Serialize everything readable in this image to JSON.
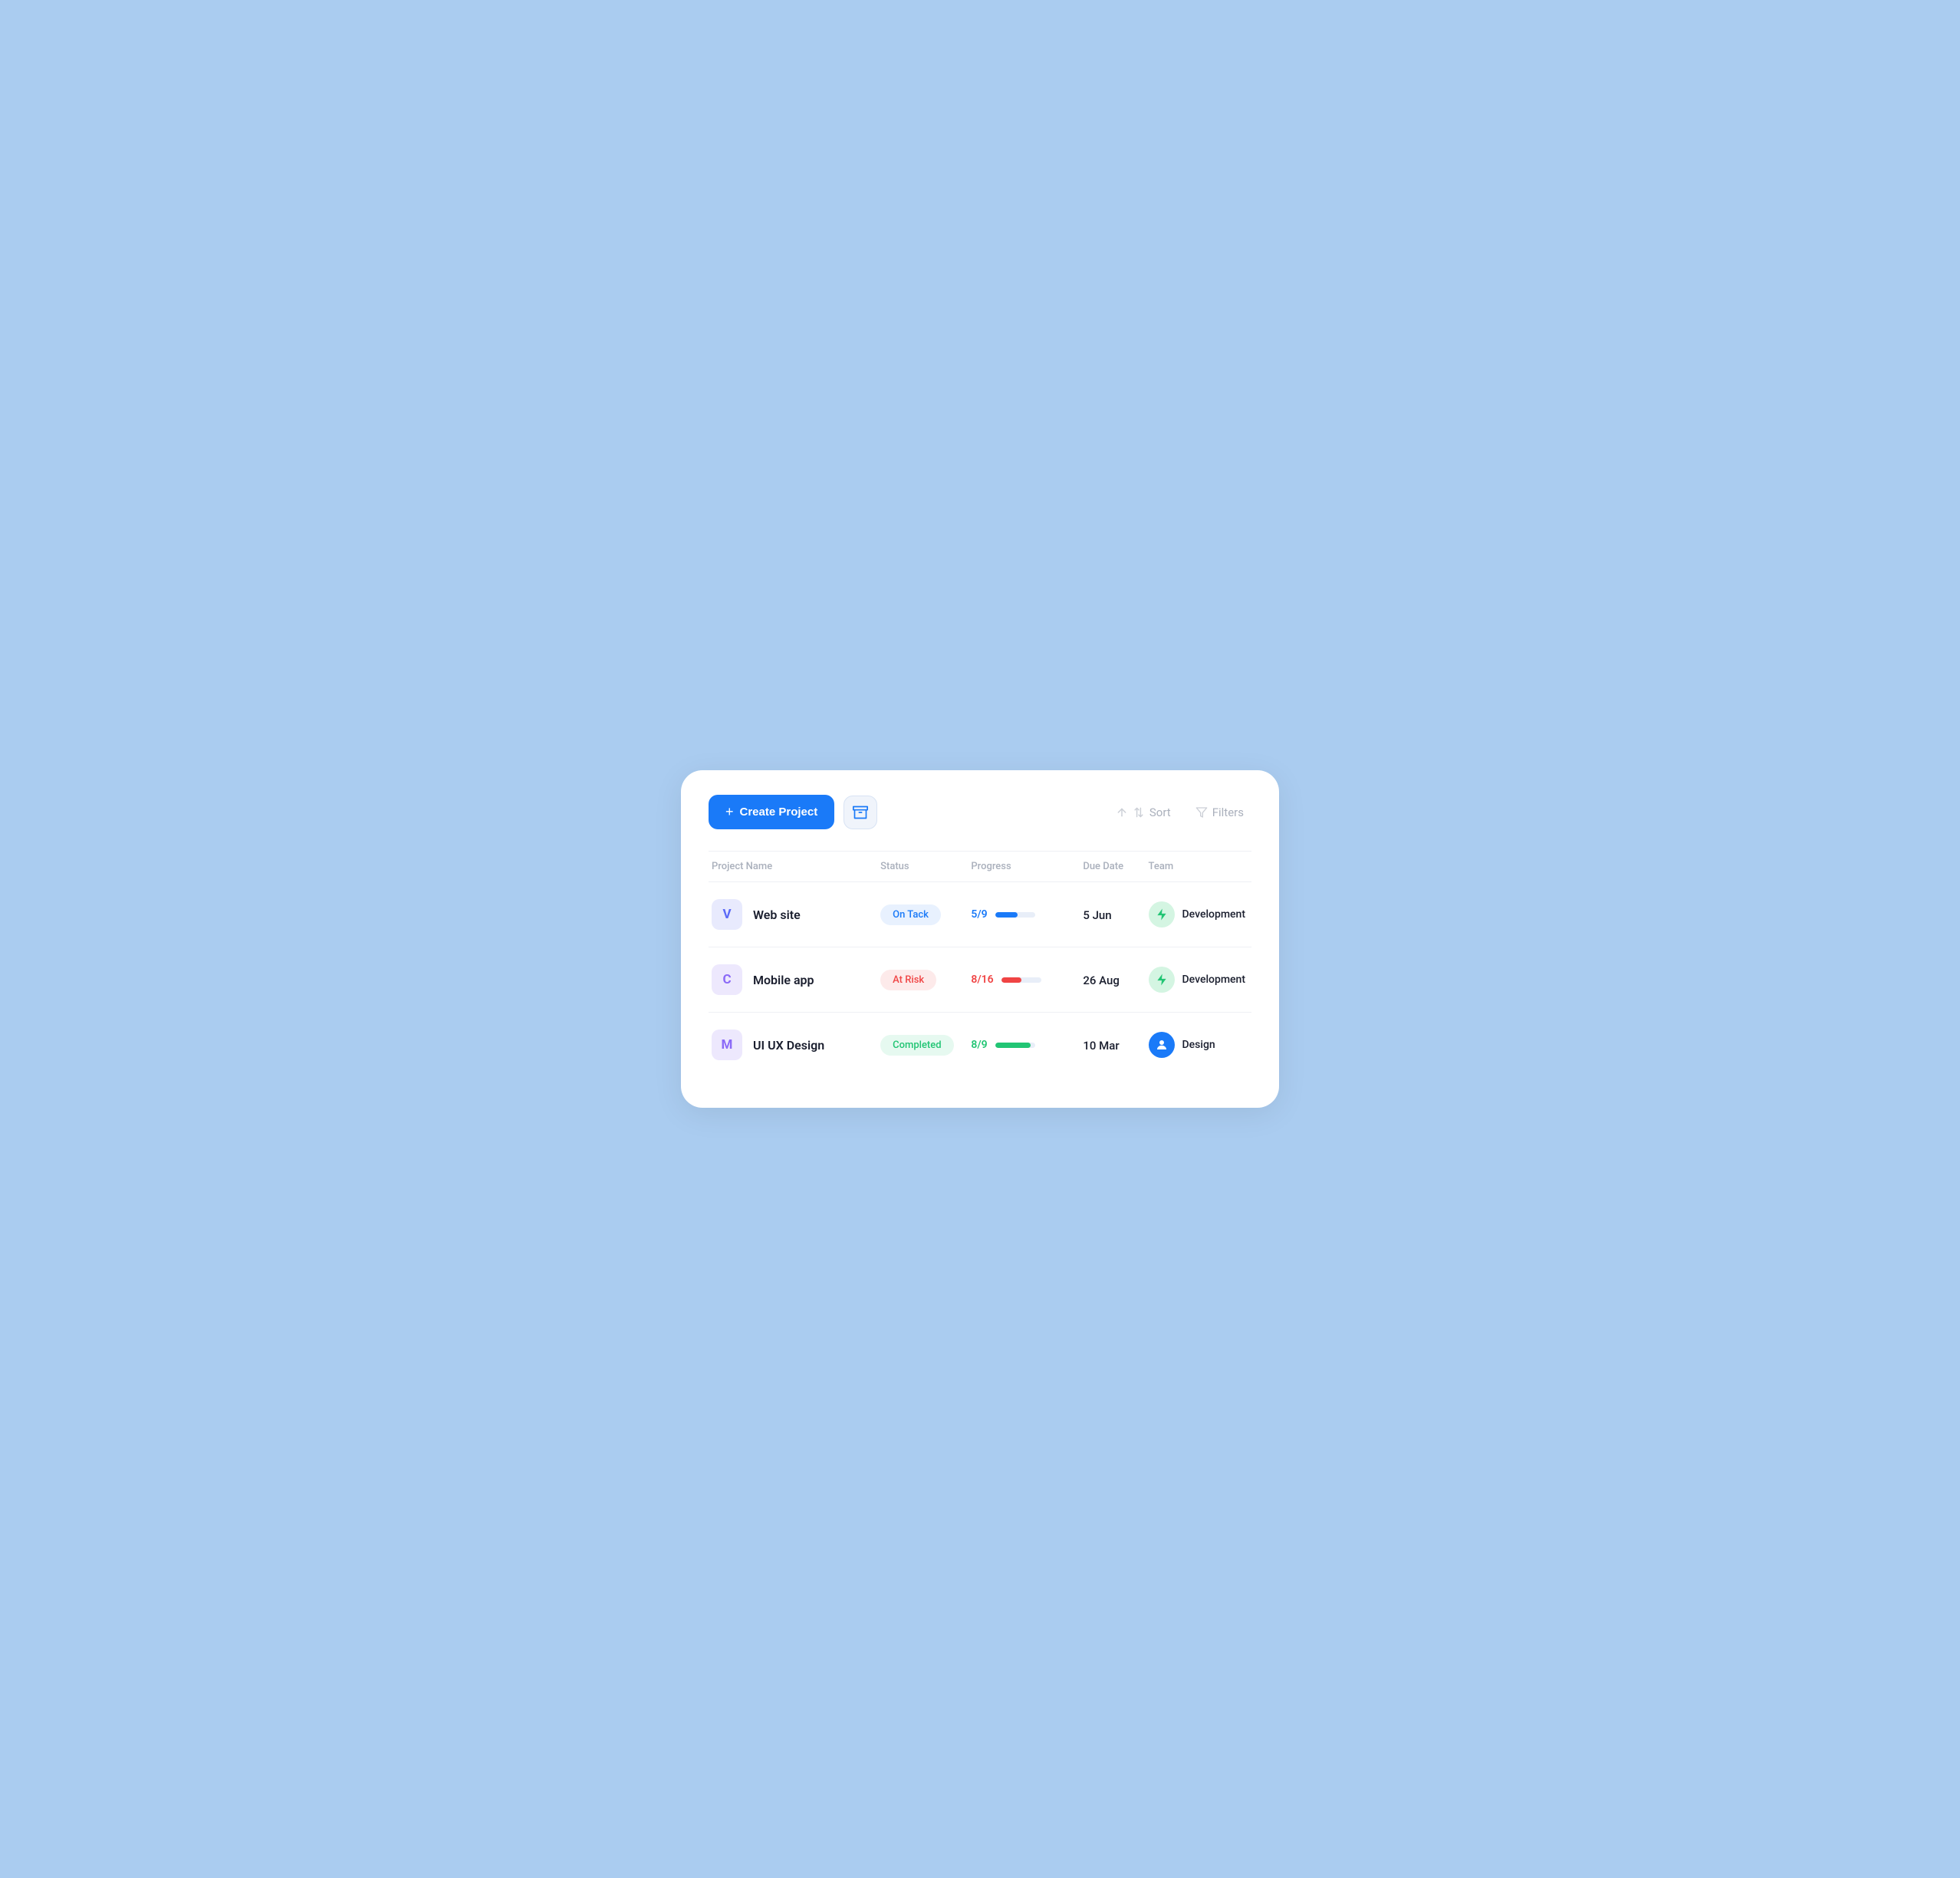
{
  "toolbar": {
    "create_label": "Create Project",
    "sort_label": "Sort",
    "filters_label": "Filters"
  },
  "table": {
    "headers": {
      "project_name": "Project Name",
      "status": "Status",
      "progress": "Progress",
      "due_date": "Due Date",
      "team": "Team"
    },
    "rows": [
      {
        "avatar_letter": "V",
        "avatar_class": "avatar-v",
        "project_name": "Web site",
        "status_label": "On Tack",
        "status_class": "badge-on-track",
        "progress_done": 5,
        "progress_total": 9,
        "progress_fraction": "5/9",
        "progress_color": "blue",
        "progress_pct": 55,
        "due_date": "5 Jun",
        "team_name": "Development",
        "team_type": "dev"
      },
      {
        "avatar_letter": "C",
        "avatar_class": "avatar-c",
        "project_name": "Mobile app",
        "status_label": "At Risk",
        "status_class": "badge-at-risk",
        "progress_done": 8,
        "progress_total": 16,
        "progress_fraction": "8/16",
        "progress_color": "red",
        "progress_pct": 50,
        "due_date": "26 Aug",
        "team_name": "Development",
        "team_type": "dev"
      },
      {
        "avatar_letter": "M",
        "avatar_class": "avatar-m",
        "project_name": "UI UX Design",
        "status_label": "Completed",
        "status_class": "badge-completed",
        "progress_done": 8,
        "progress_total": 9,
        "progress_fraction": "8/9",
        "progress_color": "green",
        "progress_pct": 89,
        "due_date": "10 Mar",
        "team_name": "Design",
        "team_type": "design"
      }
    ]
  }
}
